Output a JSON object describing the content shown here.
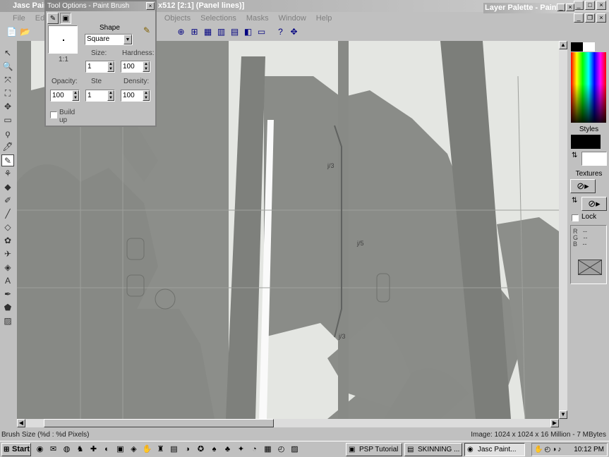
{
  "window": {
    "title": "Jasc Paint Shop Pro - [1024x512 [2:1] (Panel lines)]",
    "title_visible": "Jasc Pain",
    "title_tail": "x512 [2:1] (Panel lines)]",
    "controls": [
      "_",
      "□",
      "×"
    ]
  },
  "menu": {
    "items": [
      "File",
      "Edit",
      "View",
      "Image",
      "Colors",
      "Layers",
      "Objects",
      "Selections",
      "Masks",
      "Window",
      "Help"
    ],
    "visible": [
      "File",
      "Edi",
      "rs",
      "Objects",
      "Selections",
      "Masks",
      "Window",
      "Help"
    ]
  },
  "toolbar": {
    "icons": [
      "new-icon",
      "open-icon",
      "save-icon",
      "color-icon",
      "zoom-icon",
      "overview-icon",
      "histogram-icon",
      "layers-icon",
      "brush-icon",
      "palette-icon",
      "help-icon",
      "tool-options-icon"
    ],
    "glyphs": [
      "📄",
      "📂",
      "💾",
      "⊕",
      "⊞",
      "▦",
      "▥",
      "▤",
      "◧",
      "▭",
      "?",
      "✥"
    ]
  },
  "tools": {
    "icons": [
      "arrow-tool",
      "zoom-tool",
      "deform-tool",
      "crop-tool",
      "mover-tool",
      "selection-tool",
      "freehand-tool",
      "dropper-tool",
      "paint-brush-tool",
      "clone-brush-tool",
      "color-replacer-tool",
      "retouch-tool",
      "scratch-remover-tool",
      "eraser-tool",
      "picture-tube-tool",
      "airbrush-tool",
      "flood-fill-tool",
      "text-tool",
      "draw-tool",
      "preset-shapes-tool",
      "object-selector-tool"
    ],
    "glyphs": [
      "↖",
      "🔍",
      "⤧",
      "⛶",
      "✥",
      "▭",
      "ϙ",
      "🖊",
      "✎",
      "⚘",
      "◆",
      "✐",
      "╱",
      "◇",
      "✿",
      "✈",
      "◈",
      "A",
      "✒",
      "⬟",
      "▨"
    ],
    "active_index": 8
  },
  "tool_options": {
    "title": "Tool Options - Paint Brush",
    "shape_label": "Shape",
    "shape_value": "Square",
    "ratio": "1:1",
    "size_label": "Size:",
    "size_value": "1",
    "hardness_label": "Hardness:",
    "hardness_value": "100",
    "opacity_label": "Opacity:",
    "opacity_value": "100",
    "step_label": "Step:",
    "step_visible": "Ste",
    "step_value": "1",
    "density_label": "Density:",
    "density_value": "100",
    "build_up_label": "Build up"
  },
  "layer_palette": {
    "title": "Layer Palette - Paint",
    "title_visible": "Layer Palette - Paint"
  },
  "color_palette": {
    "styles_label": "Styles",
    "textures_label": "Textures",
    "lock_label": "Lock",
    "rgb_labels": [
      "R",
      "G",
      "B"
    ],
    "rgb_values": [
      "--",
      "--",
      "--"
    ]
  },
  "status": {
    "left": "Brush Size (%d : %d Pixels)",
    "right": "Image:  1024 x 1024 x 16 Million - 7 MBytes"
  },
  "taskbar": {
    "start_label": "Start",
    "quick_launch": [
      "ie-icon",
      "outlook-icon",
      "desktop-icon",
      "paint-icon",
      "aid-icon",
      "app-icon",
      "folder-icon",
      "winamp-icon",
      "app-icon",
      "network-icon",
      "app-icon",
      "game-icon",
      "app-icon",
      "app-icon",
      "app-icon",
      "app-icon",
      "app-icon",
      "app-icon",
      "clock-icon",
      "app-icon"
    ],
    "quick_glyphs": [
      "◉",
      "✉",
      "◍",
      "♞",
      "✚",
      "◐",
      "▣",
      "◈",
      "✋",
      "♜",
      "▤",
      "◑",
      "✪",
      "♠",
      "♣",
      "✦",
      "◔",
      "▦",
      "◴",
      "▨"
    ],
    "tasks": [
      {
        "label": "PSP Tutorial",
        "active": false
      },
      {
        "label": "SKINNING ...",
        "active": false
      },
      {
        "label": "Jasc Paint...",
        "active": true
      }
    ],
    "clock": "10:12 PM"
  }
}
